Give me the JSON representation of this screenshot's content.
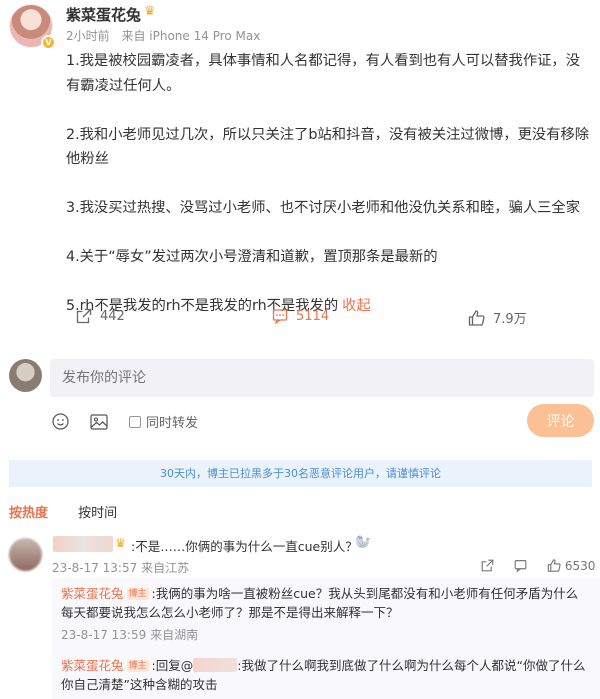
{
  "post": {
    "username": "紫菜蛋花兔",
    "time": "2小时前",
    "source": "来自 iPhone 14 Pro Max",
    "paragraphs": [
      "1.我是被校园霸凌者，具体事情和人名都记得，有人看到也有人可以替我作证，没有霸凌过任何人。",
      "2.我和小老师见过几次，所以只关注了b站和抖音，没有被关注过微博，更没有移除他粉丝",
      "3.我没买过热搜、没骂过小老师、也不讨厌小老师和他没仇关系和睦，骗人三全家",
      "4.关于“辱女”发过两次小号澄清和道歉，置顶那条是最新的"
    ],
    "last_paragraph": "5.rh不是我发的rh不是我发的rh不是我发的",
    "collapse_label": "收起"
  },
  "actions": {
    "repost_count": "442",
    "comment_count": "5114",
    "like_count": "7.9万"
  },
  "comment_box": {
    "placeholder": "发布你的评论",
    "repost_toggle_label": "同时转发",
    "submit_label": "评论"
  },
  "notice": "30天内，博主已拉黑多于30名恶意评论用户，请谨慎评论",
  "sort": {
    "hot": "按热度",
    "time": "按时间"
  },
  "comments": [
    {
      "text": ":不是……你俩的事为什么一直cue别人？",
      "date": "23-8-17 13:57",
      "location": "来自江苏",
      "like_count": "6530",
      "replies": [
        {
          "name": "紫菜蛋花兔",
          "badge": "博主",
          "text": ":我俩的事为啥一直被粉丝cue？我从头到尾都没有和小老师有任何矛盾为什么每天都要说我怎么怎么小老师了？那是不是得出来解释一下？",
          "date": "23-8-17 13:59",
          "location": "来自湖南"
        },
        {
          "name": "紫菜蛋花兔",
          "badge": "博主",
          "prefix": ":回复@",
          "text": ":我做了什么啊我到底做了什么啊为什么每个人都说“你做了什么你自己清楚”这种含糊的攻击"
        }
      ]
    }
  ]
}
